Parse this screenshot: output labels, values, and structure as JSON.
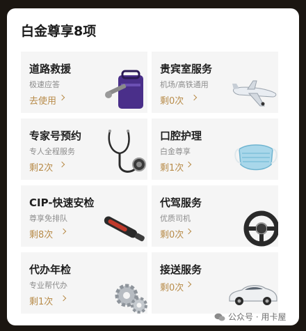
{
  "card": {
    "title": "白金尊享8项"
  },
  "services": [
    {
      "name": "道路救援",
      "desc": "极速应答",
      "status": "去使用",
      "icon": "tools-bag-icon"
    },
    {
      "name": "贵宾室服务",
      "desc": "机场/高铁通用",
      "status": "剩0次",
      "icon": "airplane-icon"
    },
    {
      "name": "专家号预约",
      "desc": "专人全程服务",
      "status": "剩2次",
      "icon": "stethoscope-icon"
    },
    {
      "name": "口腔护理",
      "desc": "白金尊享",
      "status": "剩1次",
      "icon": "face-mask-icon"
    },
    {
      "name": "CIP-快速安检",
      "desc": "尊享免排队",
      "status": "剩8次",
      "icon": "metal-detector-icon"
    },
    {
      "name": "代驾服务",
      "desc": "优质司机",
      "status": "剩0次",
      "icon": "steering-wheel-icon"
    },
    {
      "name": "代办年检",
      "desc": "专业帮代办",
      "status": "剩1次",
      "icon": "gears-icon"
    },
    {
      "name": "接送服务",
      "desc": "",
      "status": "剩0次",
      "icon": "car-icon"
    }
  ],
  "watermark": {
    "text": "公众号 · 用卡屋"
  },
  "colors": {
    "accent": "#b88c4a",
    "tile_bg": "#f5f5f5",
    "page_bg": "#1b1611"
  }
}
